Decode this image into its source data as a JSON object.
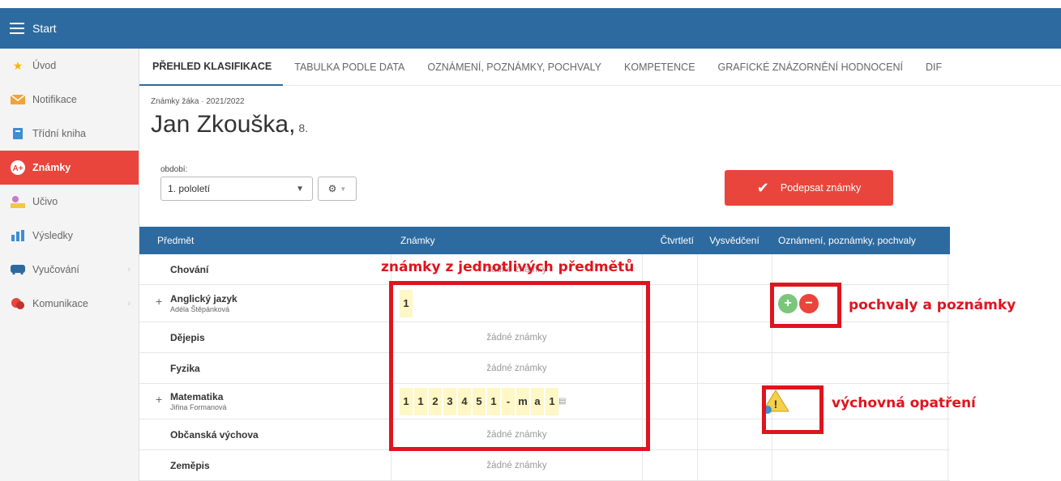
{
  "topbar": {
    "title": "Start"
  },
  "sidebar": {
    "items": [
      {
        "label": "Úvod",
        "icon": "star-icon"
      },
      {
        "label": "Notifikace",
        "icon": "envelope-icon"
      },
      {
        "label": "Třídní kniha",
        "icon": "book-icon"
      },
      {
        "label": "Známky",
        "icon": "grades-icon",
        "active": true
      },
      {
        "label": "Učivo",
        "icon": "teacher-icon"
      },
      {
        "label": "Výsledky",
        "icon": "bar-chart-icon"
      },
      {
        "label": "Vyučování",
        "icon": "bus-icon"
      },
      {
        "label": "Komunikace",
        "icon": "chat-icon"
      }
    ]
  },
  "tabs": [
    "PŘEHLED KLASIFIKACE",
    "TABULKA PODLE DATA",
    "OZNÁMENÍ, POZNÁMKY, POCHVALY",
    "KOMPETENCE",
    "GRAFICKÉ ZNÁZORNĚNÍ HODNOCENÍ",
    "DIF"
  ],
  "header": {
    "subtitle": "Známky žáka · 2021/2022",
    "student_name": "Jan Zkouška,",
    "student_class": "8."
  },
  "period": {
    "label": "období:",
    "value": "1. pololetí"
  },
  "sign_button": {
    "label": "Podepsat známky"
  },
  "table": {
    "headers": {
      "subject": "Předmět",
      "grades": "Známky",
      "quarter": "Čtvrtletí",
      "report": "Vysvědčení",
      "notes": "Oznámení, poznámky, pochvaly"
    },
    "no_grades": "žádné známky",
    "rows": [
      {
        "subject": "Chování",
        "teacher": "",
        "grades": [],
        "no_grades_text": "žádné známky"
      },
      {
        "subject": "Anglický jazyk",
        "teacher": "Adéla Štěpánková",
        "grades": [
          "1"
        ]
      },
      {
        "subject": "Dějepis",
        "teacher": "",
        "grades": [],
        "no_grades_text": "žádné známky"
      },
      {
        "subject": "Fyzika",
        "teacher": "",
        "grades": [],
        "no_grades_text": "žádné známky"
      },
      {
        "subject": "Matematika",
        "teacher": "Jiřina Formanová",
        "grades": [
          "1",
          "1",
          "2",
          "3",
          "4",
          "5",
          "1",
          "-",
          "m",
          "a",
          "1"
        ]
      },
      {
        "subject": "Občanská výchova",
        "teacher": "",
        "grades": [],
        "no_grades_text": "žádné známky"
      },
      {
        "subject": "Zeměpis",
        "teacher": "",
        "grades": [],
        "no_grades_text": "žádné známky"
      }
    ]
  },
  "annotations": {
    "grades": "známky z jednotlivých předmětů",
    "praise": "pochvaly a poznámky",
    "measures": "výchovná opatření"
  },
  "colors": {
    "topbar": "#2d6a9f",
    "accent_red": "#e9453c",
    "annotation_red": "#e0141e"
  }
}
